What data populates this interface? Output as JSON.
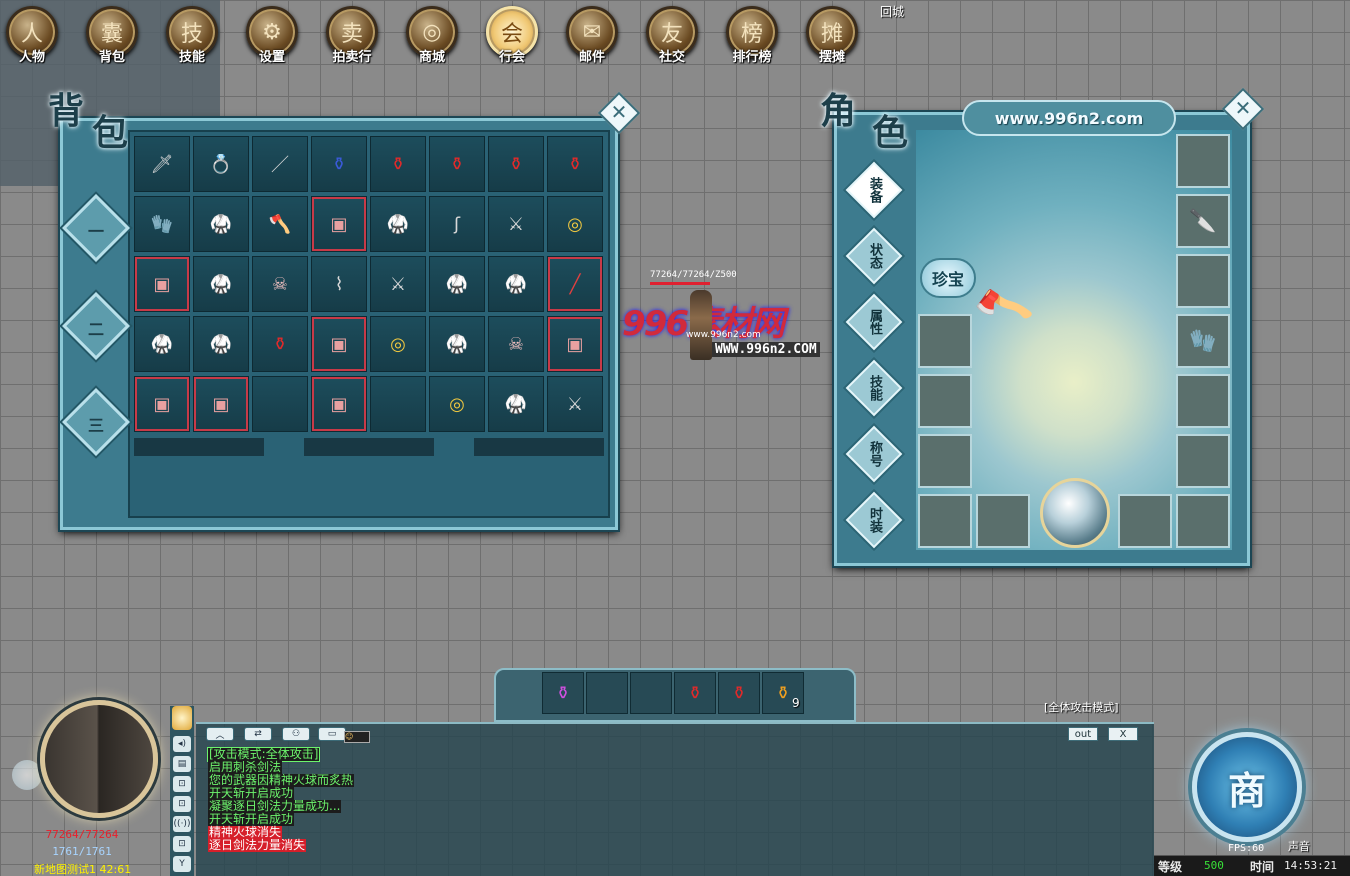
{
  "menu": [
    {
      "label": "人物",
      "icon": "person-icon",
      "glyph": "人"
    },
    {
      "label": "背包",
      "icon": "bag-icon",
      "glyph": "囊"
    },
    {
      "label": "技能",
      "icon": "skill-icon",
      "glyph": "技"
    },
    {
      "label": "设置",
      "icon": "gear-icon",
      "glyph": "⚙"
    },
    {
      "label": "拍卖行",
      "icon": "auction-icon",
      "glyph": "卖"
    },
    {
      "label": "商城",
      "icon": "mall-icon",
      "glyph": "◎"
    },
    {
      "label": "行会",
      "icon": "guild-icon",
      "glyph": "会",
      "active": true
    },
    {
      "label": "邮件",
      "icon": "mail-icon",
      "glyph": "✉"
    },
    {
      "label": "社交",
      "icon": "social-icon",
      "glyph": "友"
    },
    {
      "label": "排行榜",
      "icon": "ranking-icon",
      "glyph": "榜"
    },
    {
      "label": "摆摊",
      "icon": "stall-icon",
      "glyph": "摊"
    }
  ],
  "return_city": "回城",
  "bag": {
    "title_a": "背",
    "title_b": "包",
    "tabs": [
      "一",
      "二",
      "三"
    ],
    "items": [
      [
        "blade",
        "ring",
        "staff",
        "blue-potion",
        "red-potion",
        "red-potion",
        "red-potion",
        "red-potion"
      ],
      [
        "glove",
        "armor",
        "axe",
        "armor-red",
        "armor-white",
        "hook",
        "sword",
        "gold-ring"
      ],
      [
        "armor-red",
        "armor-green",
        "helmet",
        "cane",
        "sword",
        "armor",
        "armor-white",
        "bow-red"
      ],
      [
        "armor-green",
        "armor-white",
        "red-potion",
        "armor-red",
        "gold-ring",
        "armor-white",
        "helmet",
        "armor-red"
      ],
      [
        "armor-red",
        "armor-red",
        "",
        "armor-red",
        "",
        "gold-ring",
        "armor-green",
        "sword"
      ]
    ]
  },
  "character": {
    "title_a": "角",
    "title_b": "色",
    "url": "www.996n2.com",
    "tabs": [
      "装备",
      "状态",
      "属性",
      "技能",
      "称号",
      "时装"
    ],
    "treasure": "珍宝"
  },
  "watermark": {
    "hp_label": "77264/77264/Z500",
    "brand": "996素材网",
    "small_url": "www.996n2.com",
    "big_url": "WWW.996n2.COM"
  },
  "quickbar": {
    "count": "9"
  },
  "chat": {
    "mode_hint": "[全体攻击模式]",
    "out_label": "out",
    "close_label": "X",
    "lines": [
      {
        "text": "[攻击模式:全体攻击]",
        "style": "greenbox"
      },
      {
        "text": "启用刺杀剑法",
        "style": "green"
      },
      {
        "text": "您的武器因精神火球而炙热",
        "style": "green"
      },
      {
        "text": "开天斩开启成功",
        "style": "green"
      },
      {
        "text": "凝聚逐日剑法力量成功...",
        "style": "green"
      },
      {
        "text": "开天斩开启成功",
        "style": "green"
      },
      {
        "text": "精神火球消失",
        "style": "red"
      },
      {
        "text": "逐日剑法力量消失",
        "style": "red"
      }
    ]
  },
  "player": {
    "hp": "77264/77264",
    "mp": "1761/1761",
    "map": "新地图测试1 42:61"
  },
  "shop": {
    "label": "商",
    "sound_label": "声音"
  },
  "status": {
    "fps_label": "FPS:60",
    "level_label": "等级",
    "level_value": "500",
    "time_label": "时间",
    "time_value": "14:53:21"
  },
  "colors": {
    "panel": "#3d7b8e",
    "panel_border": "#8cc8d6",
    "hp_text": "#e8202c",
    "level_value": "#38e038"
  }
}
